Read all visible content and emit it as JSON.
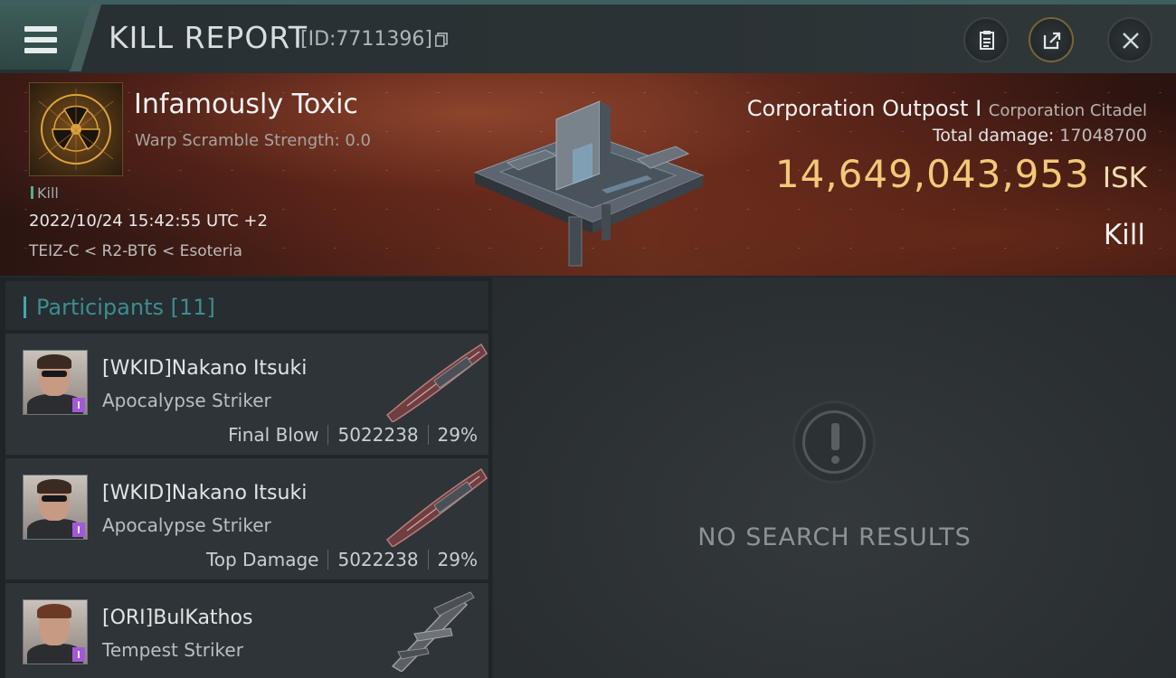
{
  "header": {
    "title": "KILL REPORT",
    "report_id": "[ID:7711396]",
    "icons": {
      "menu": "hamburger-menu-icon",
      "copy": "copy-icon",
      "clipboard": "clipboard-icon",
      "share": "share-icon",
      "close": "close-icon"
    }
  },
  "victim": {
    "name": "Infamously Toxic",
    "subtitle": "Warp Scramble Strength: 0.0",
    "kill_tag": "Kill",
    "datetime": "2022/10/24 15:42:55 UTC +2",
    "location": "TEIZ-C < R2-BT6 < Esoteria",
    "emblem": "corporation-emblem-icon"
  },
  "target": {
    "ship_name": "Corporation Outpost I",
    "ship_class": "Corporation Citadel",
    "total_damage_label": "Total damage:",
    "total_damage_value": "17048700",
    "isk_value": "14,649,043,953",
    "isk_unit": "ISK",
    "result": "Kill"
  },
  "participants": {
    "header": "Participants [11]",
    "rows": [
      {
        "name": "[WKID]Nakano Itsuki",
        "ship": "Apocalypse Striker",
        "role": "Final Blow",
        "damage": "5022238",
        "percent": "29%"
      },
      {
        "name": "[WKID]Nakano Itsuki",
        "ship": "Apocalypse Striker",
        "role": "Top Damage",
        "damage": "5022238",
        "percent": "29%"
      },
      {
        "name": "[ORI]BulKathos",
        "ship": "Tempest Striker",
        "role": "",
        "damage": "",
        "percent": ""
      }
    ]
  },
  "right_panel": {
    "empty_text": "NO SEARCH RESULTS",
    "icon": "exclamation-icon"
  },
  "colors": {
    "accent": "#3fa9a9",
    "isk": "#f3c979",
    "kill_marker": "#4db08d"
  }
}
